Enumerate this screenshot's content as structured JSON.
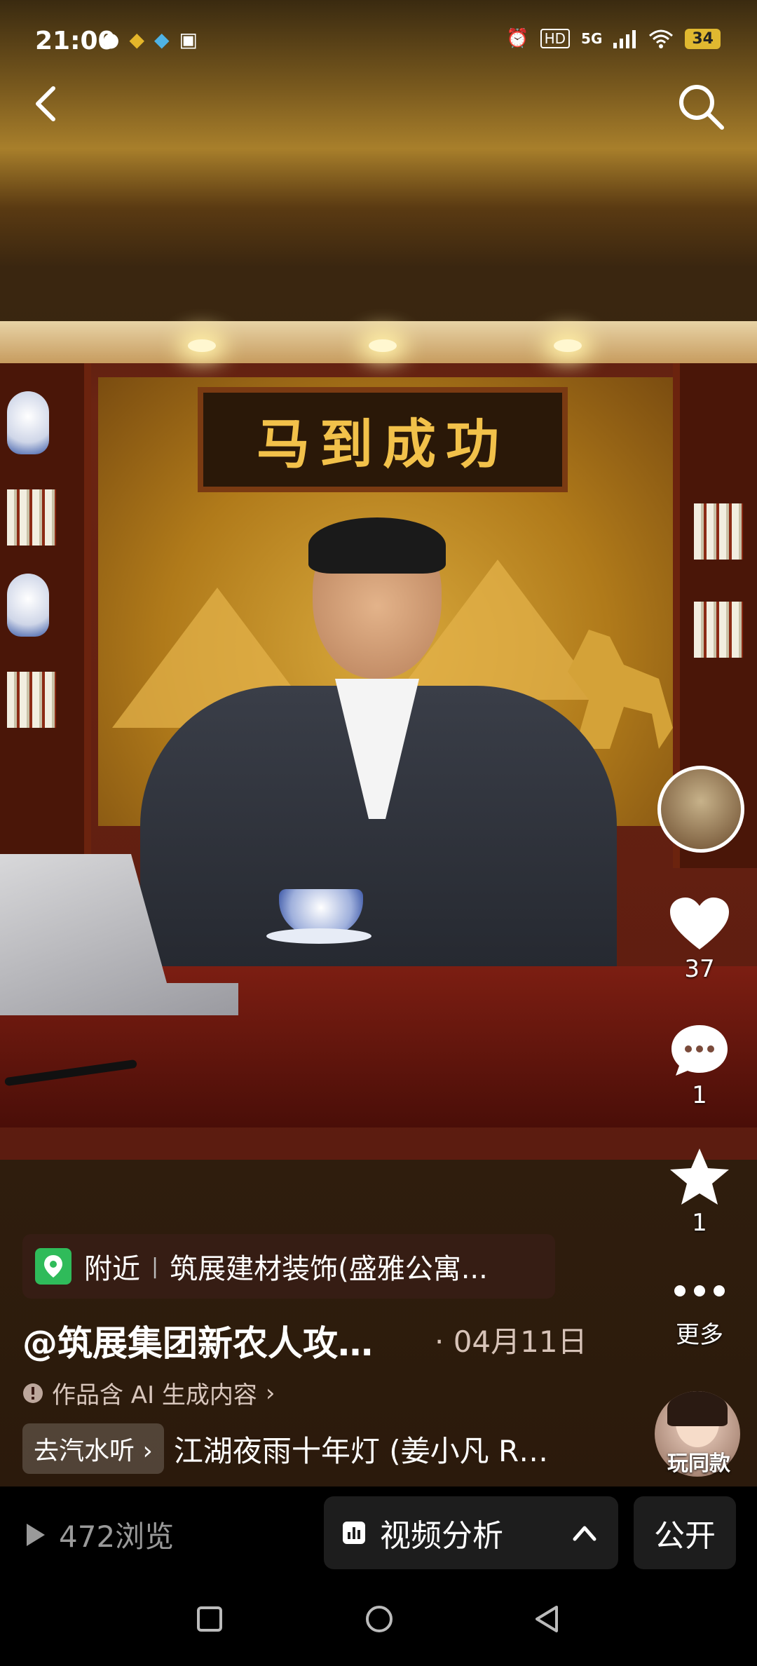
{
  "status_bar": {
    "time": "21:00",
    "network": "5G",
    "hd": "HD",
    "battery": "34",
    "icons": [
      "wechat-icon",
      "app-icon",
      "app-icon",
      "calendar-icon",
      "alarm-icon",
      "signal-icon",
      "wifi-icon"
    ]
  },
  "top_bar": {
    "back_icon": "chevron-left-icon",
    "search_icon": "search-icon"
  },
  "media": {
    "plaque_text": "马到成功"
  },
  "rail": {
    "like_count": "37",
    "comment_count": "1",
    "favorite_count": "1",
    "more_label": "更多"
  },
  "overlay": {
    "location_prefix": "附近",
    "location_name": "筑展建材装饰(盛雅公寓...",
    "author": "@筑展集团新农人攻…",
    "date": "04月11日",
    "ai_note": "作品含 AI 生成内容",
    "music_button": "去汽水听",
    "music_title": "江湖夜雨十年灯 (姜小凡 R…",
    "same_style_label": "玩同款"
  },
  "toolbar": {
    "views": "472浏览",
    "analysis_label": "视频分析",
    "public_label": "公开"
  },
  "colors": {
    "accent_green": "#2fbb5a",
    "toolbar_bg": "#1d1d1d"
  }
}
